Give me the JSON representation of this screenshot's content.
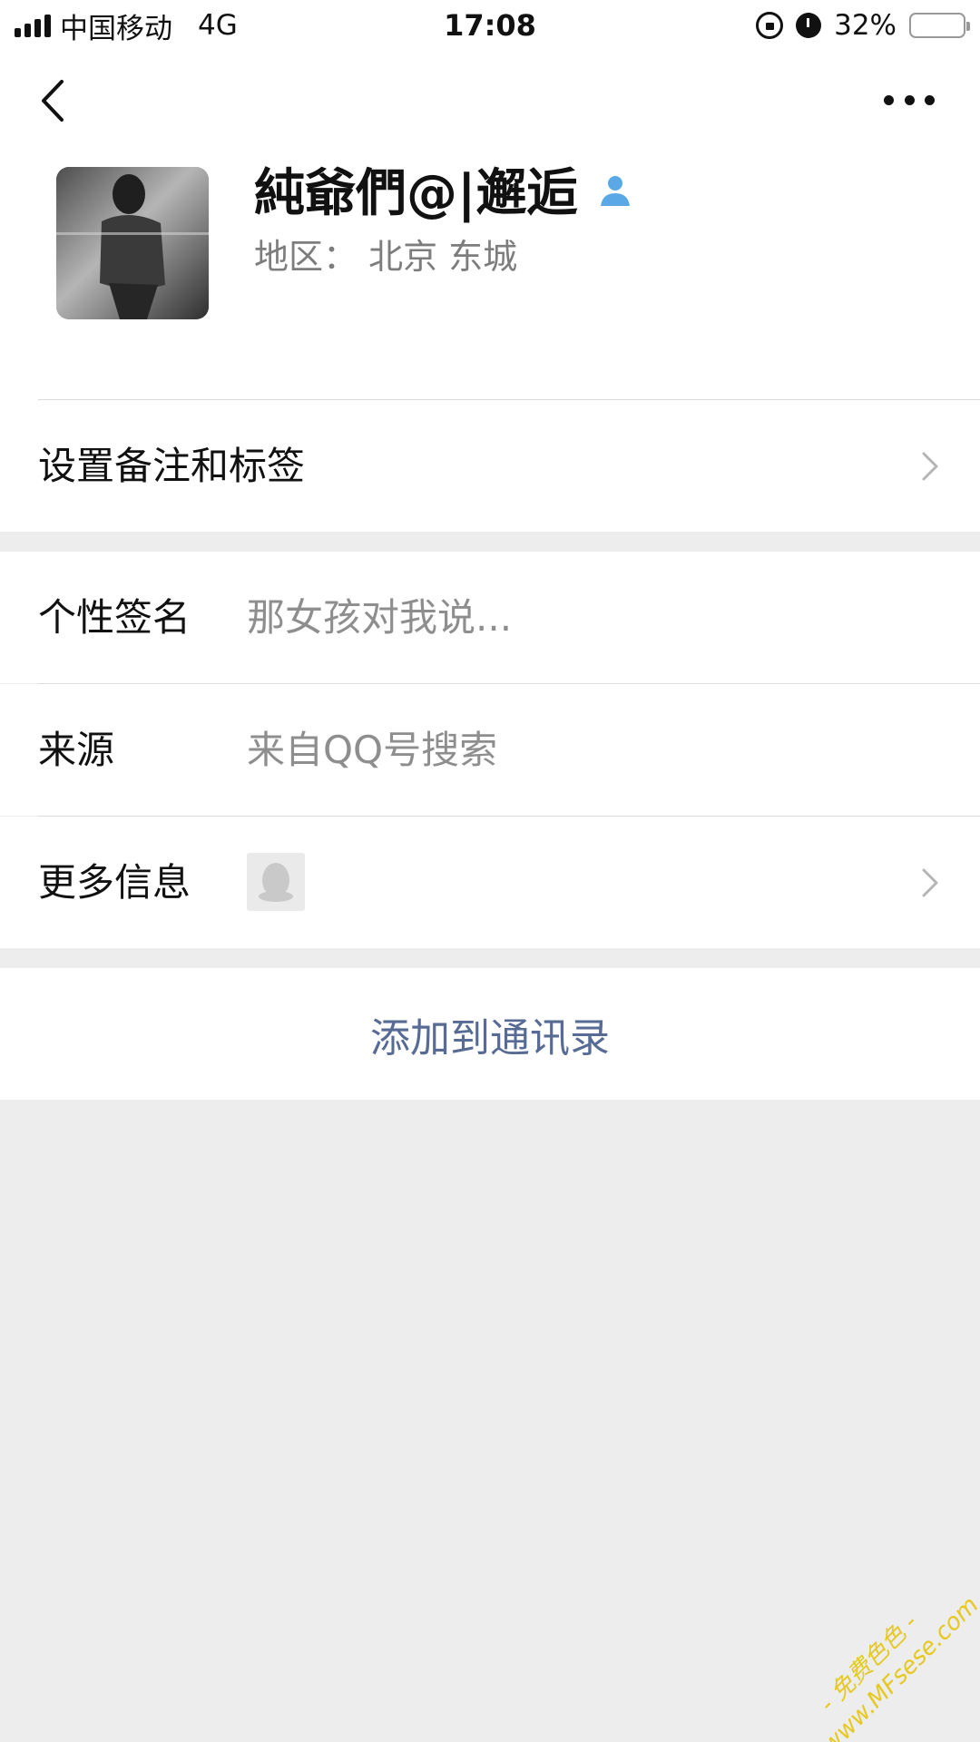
{
  "status_bar": {
    "carrier": "中国移动",
    "network": "4G",
    "time": "17:08",
    "battery": "32%",
    "battery_level": 0.32,
    "battery_color": "#f3c842"
  },
  "nav": {
    "back_icon": "chevron-left-icon",
    "more_icon": "more-dots-icon"
  },
  "profile": {
    "nickname": "純爺們@|邂逅",
    "region": "地区：  北京 东城",
    "badge_icon": "contact-person-icon",
    "badge_color": "#5aa9e6"
  },
  "rows": {
    "remark": {
      "label": "设置备注和标签"
    },
    "signature": {
      "label": "个性签名",
      "value": "那女孩对我说..."
    },
    "source": {
      "label": "来源",
      "value": "来自QQ号搜索"
    },
    "more_info": {
      "label": "更多信息",
      "thumb_icon": "qq-penguin-icon"
    }
  },
  "actions": {
    "add_to_contacts": "添加到通讯录",
    "link_color": "#576b95"
  },
  "watermark": {
    "line1": "- 免费色色 -",
    "line2": "www.MFsese.com"
  }
}
